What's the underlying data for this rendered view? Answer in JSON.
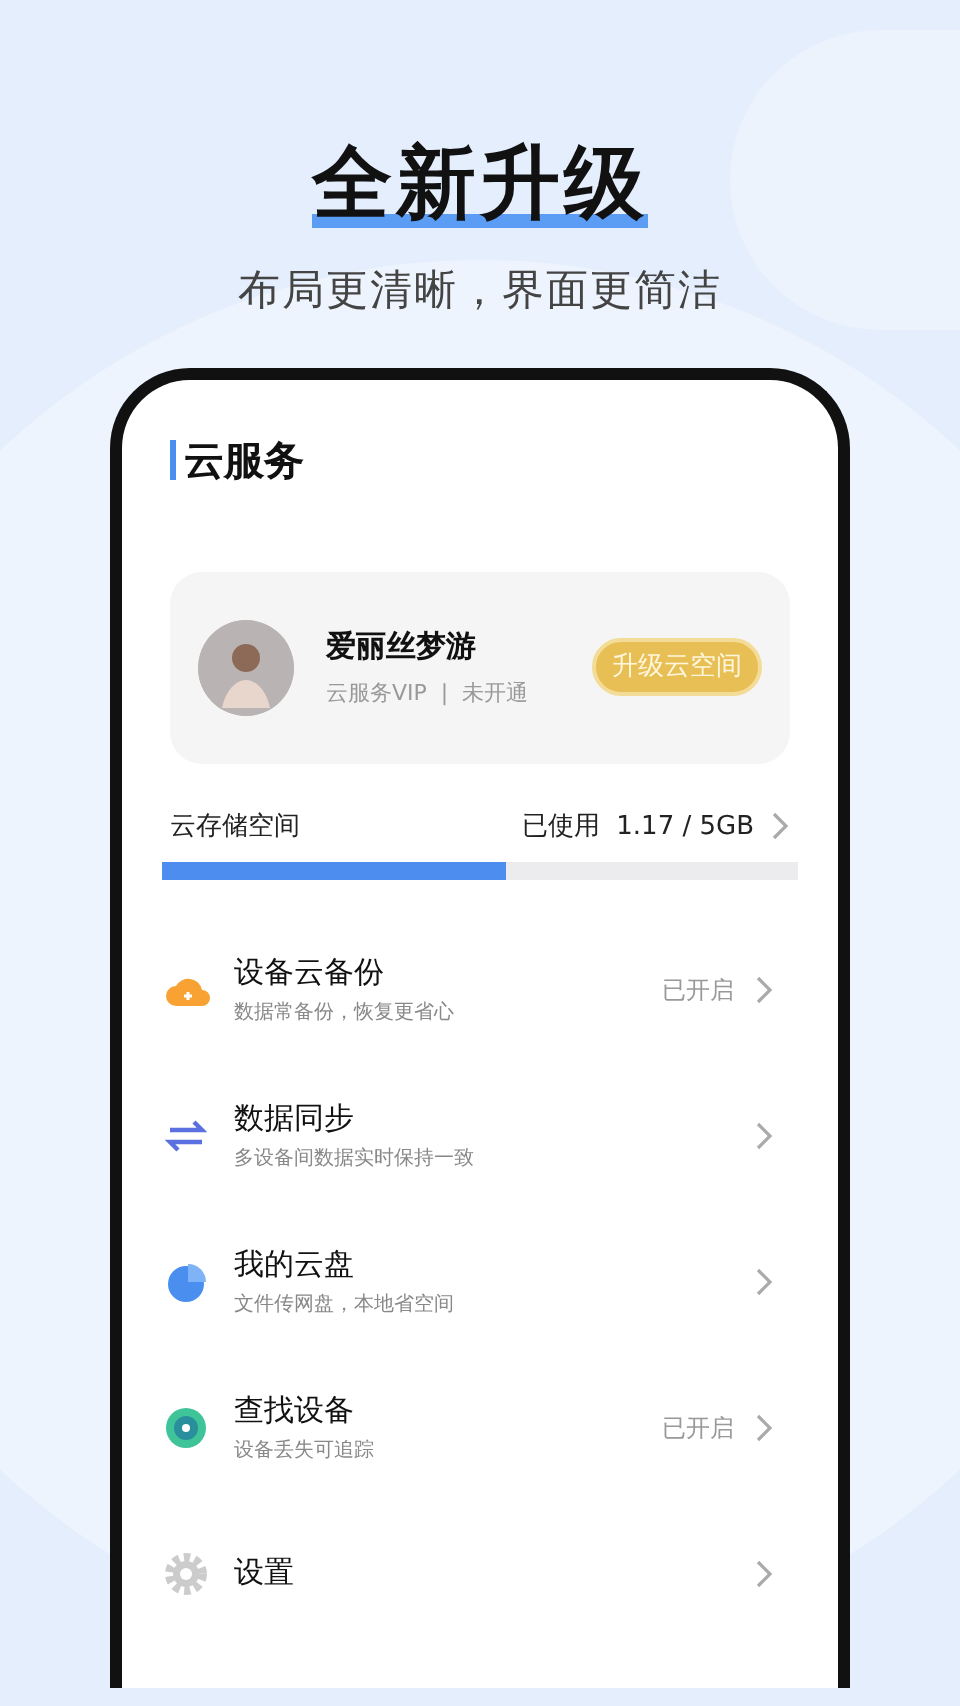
{
  "headline": "全新升级",
  "subtitle": "布局更清晰，界面更简洁",
  "page_title": "云服务",
  "profile": {
    "name": "爱丽丝梦游",
    "plan": "云服务VIP",
    "separator": "|",
    "plan_status": "未开通",
    "upgrade_button": "升级云空间"
  },
  "storage": {
    "label": "云存储空间",
    "usage": "已使用  1.17 / 5GB",
    "level": 0.54
  },
  "items": [
    {
      "kind": "backup",
      "title": "设备云备份",
      "subtitle": "数据常备份，恢复更省心",
      "status": "已开启"
    },
    {
      "kind": "sync",
      "title": "数据同步",
      "subtitle": "多设备间数据实时保持一致"
    },
    {
      "kind": "disk",
      "title": "我的云盘",
      "subtitle": "文件传网盘，本地省空间"
    },
    {
      "kind": "find",
      "title": "查找设备",
      "subtitle": "设备丢失可追踪",
      "status": "已开启"
    },
    {
      "kind": "settings",
      "title": "设置"
    }
  ]
}
